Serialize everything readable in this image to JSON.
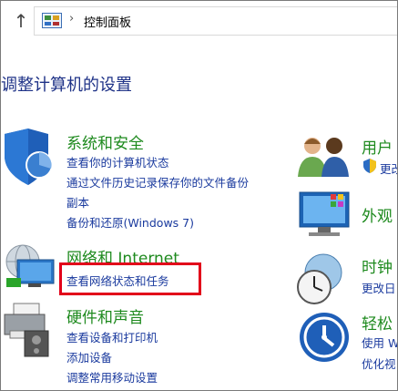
{
  "address_bar": {
    "up_arrow": "↑",
    "separator": "›",
    "breadcrumb": "控制面板"
  },
  "page_title": "调整计算机的设置",
  "categories_left": [
    {
      "title": "系统和安全",
      "links": [
        "查看你的计算机状态",
        "通过文件历史记录保存你的文件备份",
        "副本",
        "备份和还原(Windows 7)"
      ]
    },
    {
      "title": "网络和 Internet",
      "links": [
        "查看网络状态和任务"
      ]
    },
    {
      "title": "硬件和声音",
      "links": [
        "查看设备和打印机",
        "添加设备",
        "调整常用移动设置"
      ]
    }
  ],
  "categories_right": [
    {
      "title": "用户",
      "links": [
        "更改"
      ]
    },
    {
      "title": "外观",
      "links": []
    },
    {
      "title": "时钟",
      "links": [
        "更改日"
      ]
    },
    {
      "title": "轻松",
      "links": [
        "使用 W",
        "优化视"
      ]
    }
  ],
  "colors": {
    "title_blue": "#1e3287",
    "category_green": "#1e8a1e",
    "link_blue": "#1a3a9e",
    "highlight_red": "#e2001a"
  }
}
